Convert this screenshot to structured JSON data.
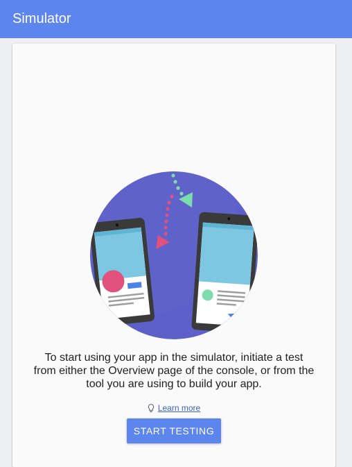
{
  "header": {
    "title": "Simulator"
  },
  "main": {
    "message": "To start using your app in the simulator, initiate a test from either the Overview page of the console, or from the tool you are using to build your app.",
    "learn_more": {
      "icon": "lightbulb-icon",
      "label": "Learn more"
    },
    "start_button_label": "START TESTING"
  },
  "colors": {
    "header_bg": "#5c85ee",
    "button_bg": "#5c85ee",
    "link": "#3a63c7",
    "illustration_circle": "#5c60c8",
    "accent_pink": "#e0517e",
    "accent_green": "#7ddcae"
  }
}
